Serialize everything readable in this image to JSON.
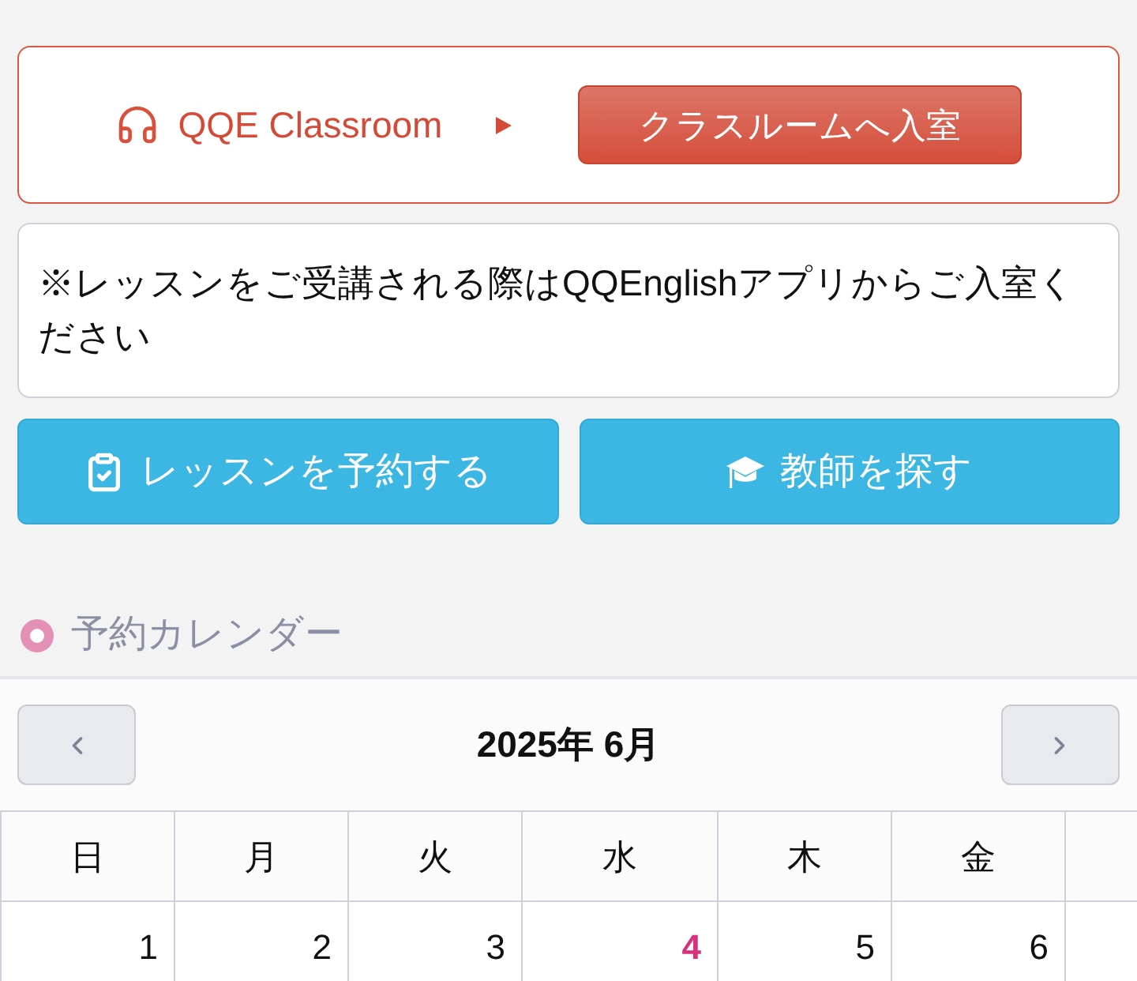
{
  "classroom": {
    "title": "QQE Classroom",
    "enter_button": "クラスルームへ入室"
  },
  "notice": "※レッスンをご受講される際はQQEnglishアプリからご入室ください",
  "actions": [
    {
      "label": "レッスンを予約する",
      "kind": "reserve"
    },
    {
      "label": "教師を探す",
      "kind": "teacher"
    }
  ],
  "calendar": {
    "heading": "予約カレンダー",
    "month": "2025年 6月",
    "weekdays": [
      "日",
      "月",
      "火",
      "水",
      "木",
      "金"
    ],
    "days": [
      {
        "label": "1",
        "today": false
      },
      {
        "label": "2",
        "today": false
      },
      {
        "label": "3",
        "today": false
      },
      {
        "label": "4",
        "today": true
      },
      {
        "label": "5",
        "today": false
      },
      {
        "label": "6",
        "today": false
      }
    ]
  }
}
